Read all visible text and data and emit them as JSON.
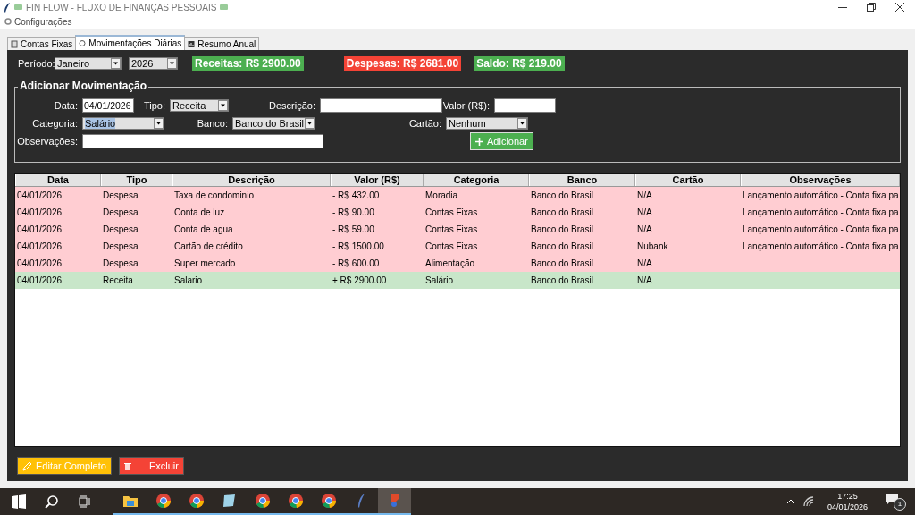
{
  "window": {
    "title": "FIN FLOW - FLUXO DE FINANÇAS PESSOAIS"
  },
  "menu": [
    {
      "label": "Configurações"
    }
  ],
  "tabs": [
    {
      "label": "Contas Fixas",
      "selected": false
    },
    {
      "label": "Movimentações Diárias",
      "selected": true
    },
    {
      "label": "Resumo Anual",
      "selected": false
    }
  ],
  "period": {
    "label": "Período:",
    "month": "Janeiro",
    "year": "2026"
  },
  "summary": [
    {
      "text": "Receitas: R$ 2900.00",
      "color": "#4caf50"
    },
    {
      "text": "Despesas: R$ 2681.00",
      "color": "#f44336"
    },
    {
      "text": "Saldo: R$ 219.00",
      "color": "#4caf50"
    }
  ],
  "form": {
    "title": "Adicionar Movimentação",
    "rows": [
      {
        "fields": [
          {
            "label": "Data:",
            "kind": "text",
            "value": "04/01/2026"
          },
          {
            "label": "Tipo:",
            "kind": "combo",
            "value": "Receita"
          },
          {
            "label": "Descrição:",
            "kind": "text"
          },
          {
            "label": "Valor (R$):",
            "kind": "text"
          }
        ]
      },
      {
        "fields": [
          {
            "label": "Categoria:",
            "kind": "combo",
            "value": "Salário",
            "highlighted": true
          },
          {
            "label": "Banco:",
            "kind": "combo",
            "value": "Banco do Brasil"
          },
          {
            "label": "Cartão:",
            "kind": "combo",
            "value": "Nenhum"
          }
        ]
      },
      {
        "fields": [
          {
            "label": "Observações:",
            "kind": "text"
          }
        ]
      }
    ],
    "add_button": "Adicionar"
  },
  "table": {
    "columns": [
      "Data",
      "Tipo",
      "Descrição",
      "Valor (R$)",
      "Categoria",
      "Banco",
      "Cartão",
      "Observações"
    ],
    "rows": [
      {
        "kind": "expense",
        "cells": [
          "04/01/2026",
          "Despesa",
          "Taxa de condominio",
          "- R$ 432.00",
          "Moradia",
          "Banco do Brasil",
          "N/A",
          "Lançamento automático - Conta fixa pa"
        ]
      },
      {
        "kind": "expense",
        "cells": [
          "04/01/2026",
          "Despesa",
          "Conta de luz",
          "- R$ 90.00",
          "Contas Fixas",
          "Banco do Brasil",
          "N/A",
          "Lançamento automático - Conta fixa pa"
        ]
      },
      {
        "kind": "expense",
        "cells": [
          "04/01/2026",
          "Despesa",
          "Conta de agua",
          "- R$ 59.00",
          "Contas Fixas",
          "Banco do Brasil",
          "N/A",
          "Lançamento automático - Conta fixa pa"
        ]
      },
      {
        "kind": "expense",
        "cells": [
          "04/01/2026",
          "Despesa",
          "Cartão de crédito",
          "- R$ 1500.00",
          "Contas Fixas",
          "Banco do Brasil",
          "Nubank",
          "Lançamento automático - Conta fixa pa"
        ]
      },
      {
        "kind": "expense",
        "cells": [
          "04/01/2026",
          "Despesa",
          "Super mercado",
          "- R$ 600.00",
          "Alimentação",
          "Banco do Brasil",
          "N/A"
        ]
      },
      {
        "kind": "income",
        "cells": [
          "04/01/2026",
          "Receita",
          "Salario",
          "+ R$ 2900.00",
          "Salário",
          "Banco do Brasil",
          "N/A"
        ]
      }
    ]
  },
  "actions": [
    {
      "kind": "edit",
      "label": "Editar Completo"
    },
    {
      "kind": "delete",
      "label": "Excluir"
    }
  ],
  "taskbar": {
    "apps": [
      {
        "kind": "folder",
        "active": false
      },
      {
        "kind": "browser",
        "active": false
      },
      {
        "kind": "browser",
        "active": false
      },
      {
        "kind": "notes",
        "active": false
      },
      {
        "kind": "browser",
        "active": false
      },
      {
        "kind": "browser",
        "active": false
      },
      {
        "kind": "browser",
        "active": false
      },
      {
        "kind": "feather",
        "active": false
      },
      {
        "kind": "app",
        "active": true
      }
    ],
    "time": "17:25",
    "date": "04/01/2026",
    "notifications": "1"
  }
}
